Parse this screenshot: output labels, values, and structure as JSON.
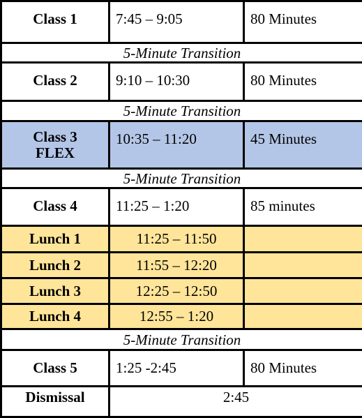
{
  "transition_label": "5-Minute Transition",
  "colors": {
    "flex_row": "#b4c6e7",
    "lunch_rows": "#ffe599"
  },
  "rows": [
    {
      "label": "Class 1",
      "time": "7:45 – 9:05",
      "duration": "80 Minutes"
    },
    {
      "label": "Class 2",
      "time": "9:10 – 10:30",
      "duration": "80 Minutes"
    },
    {
      "label": "Class 3",
      "sublabel": "FLEX",
      "time": "10:35 – 11:20",
      "duration": "45 Minutes"
    },
    {
      "label": "Class 4",
      "time": "11:25 – 1:20",
      "duration": "85 minutes"
    },
    {
      "label": "Lunch 1",
      "time": "11:25 – 11:50"
    },
    {
      "label": "Lunch 2",
      "time": "11:55 – 12:20"
    },
    {
      "label": "Lunch 3",
      "time": "12:25 – 12:50"
    },
    {
      "label": "Lunch 4",
      "time": "12:55 – 1:20"
    },
    {
      "label": "Class 5",
      "time": "1:25 -2:45",
      "duration": "80 Minutes"
    },
    {
      "label": "Dismissal",
      "time": "2:45"
    }
  ]
}
